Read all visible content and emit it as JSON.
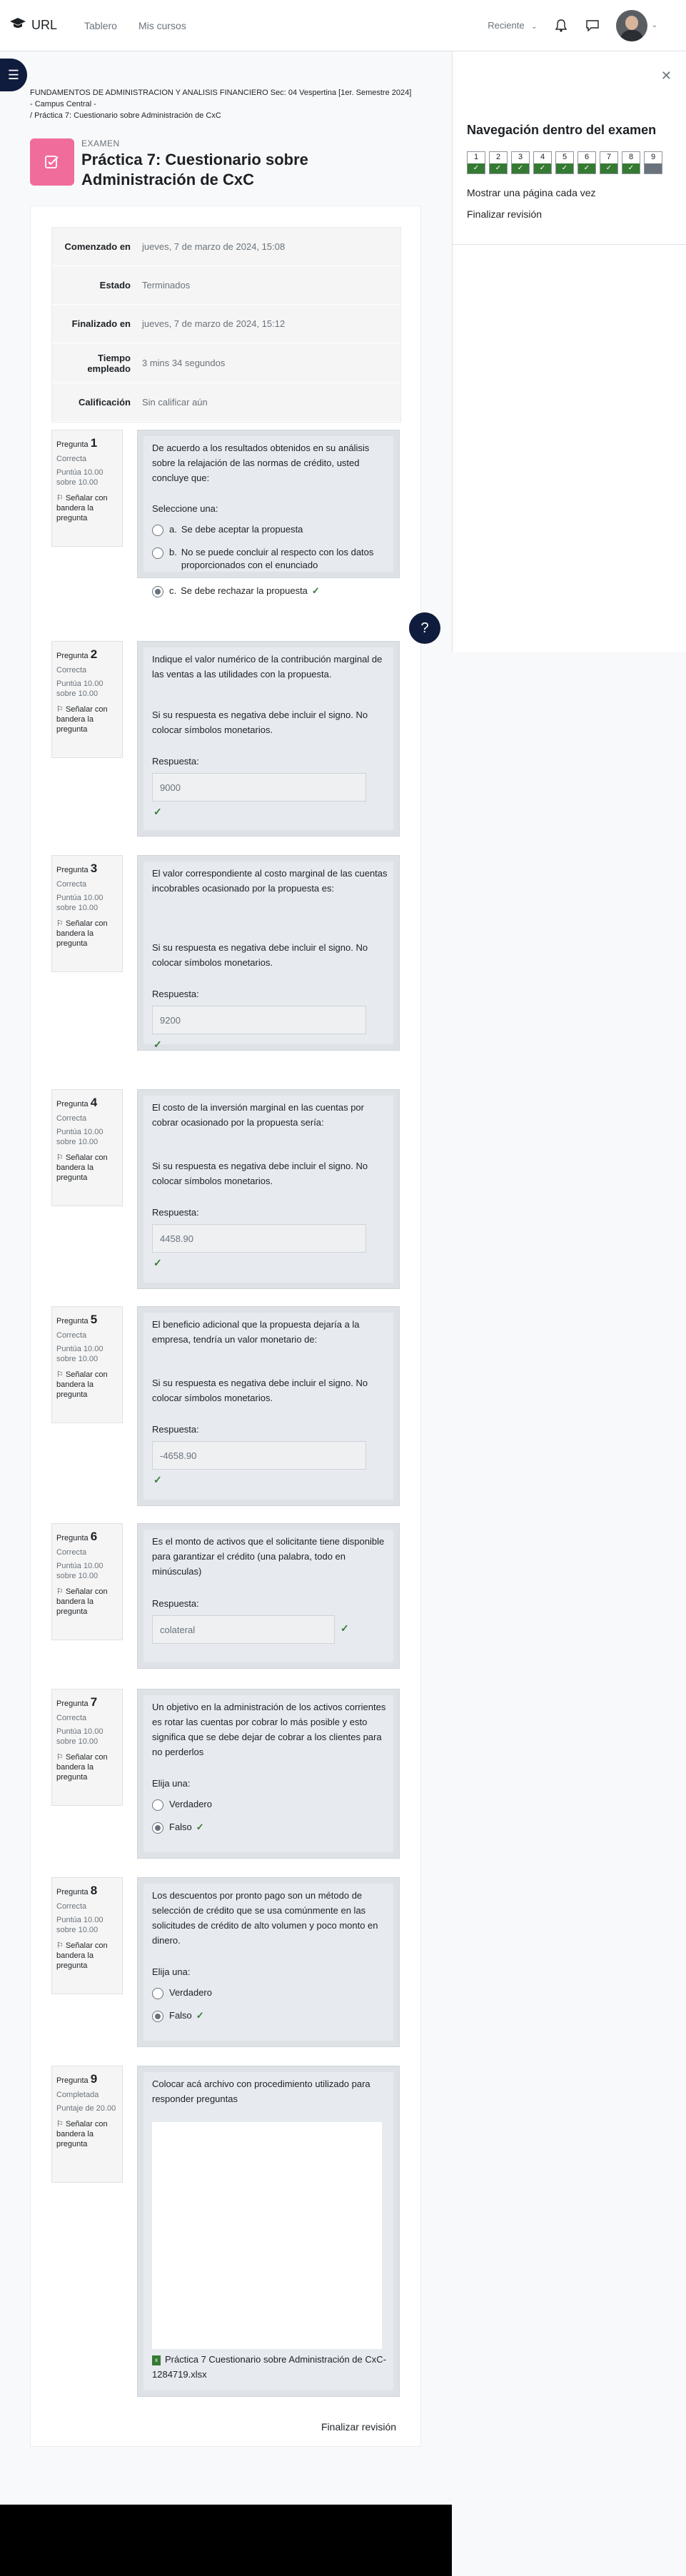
{
  "navbar": {
    "brand": "URL",
    "links": [
      "Tablero",
      "Mis cursos"
    ],
    "recent": "Reciente"
  },
  "breadcrumb": {
    "line1": "FUNDAMENTOS DE ADMINISTRACION Y ANALISIS FINANCIERO Sec: 04 Vespertina [1er. Semestre 2024]",
    "line2": "- Campus Central -",
    "line3": "/ Práctica 7: Cuestionario sobre Administración de CxC"
  },
  "header": {
    "kicker": "EXAMEN",
    "title": "Práctica 7: Cuestionario sobre Administración de CxC"
  },
  "summary": [
    {
      "label": "Comenzado en",
      "value": "jueves, 7 de marzo de 2024, 15:08"
    },
    {
      "label": "Estado",
      "value": "Terminados"
    },
    {
      "label": "Finalizado en",
      "value": "jueves, 7 de marzo de 2024, 15:12"
    },
    {
      "label": "Tiempo empleado",
      "value": "3 mins 34 segundos"
    },
    {
      "label": "Calificación",
      "value": "Sin calificar aún"
    }
  ],
  "common": {
    "pregunta": "Pregunta",
    "flag": "Señalar con bandera la pregunta",
    "respuesta": "Respuesta:",
    "seleccione": "Seleccione una:",
    "elija": "Elija una:",
    "check": "✓"
  },
  "questions": [
    {
      "num": "1",
      "state": "Correcta",
      "marks": "Puntúa 10.00 sobre 10.00",
      "text": "De acuerdo a los resultados obtenidos en su análisis sobre la relajación de las normas de crédito, usted concluye que:",
      "options": [
        {
          "letter": "a.",
          "text": "Se debe aceptar la propuesta"
        },
        {
          "letter": "b.",
          "text": "No se puede concluir al respecto con los datos proporcionados con el enunciado"
        },
        {
          "letter": "c.",
          "text": "Se debe rechazar la propuesta"
        }
      ]
    },
    {
      "num": "2",
      "state": "Correcta",
      "marks": "Puntúa 10.00 sobre 10.00",
      "text": "Indique el valor numérico de la contribución marginal de las ventas a las utilidades con la propuesta.",
      "note": "Si su respuesta es negativa debe incluir el signo.  No colocar símbolos monetarios.",
      "answer": "9000"
    },
    {
      "num": "3",
      "state": "Correcta",
      "marks": "Puntúa 10.00 sobre 10.00",
      "text": "El valor correspondiente al costo marginal de las cuentas incobrables ocasionado por la propuesta es:",
      "note": "Si su respuesta es negativa debe incluir el signo.  No colocar símbolos monetarios.",
      "answer": "9200"
    },
    {
      "num": "4",
      "state": "Correcta",
      "marks": "Puntúa 10.00 sobre 10.00",
      "text": "El costo de la inversión marginal en las cuentas por cobrar ocasionado por la propuesta sería:",
      "note": "Si su respuesta es negativa debe incluir el signo.  No colocar símbolos monetarios.",
      "answer": "4458.90"
    },
    {
      "num": "5",
      "state": "Correcta",
      "marks": "Puntúa 10.00 sobre 10.00",
      "text": "El beneficio adicional que la propuesta dejaría a la empresa, tendría un valor monetario de:",
      "note": "Si su respuesta es negativa debe incluir el signo.  No colocar símbolos monetarios.",
      "answer": "-4658.90"
    },
    {
      "num": "6",
      "state": "Correcta",
      "marks": "Puntúa 10.00 sobre 10.00",
      "text": "Es el monto de activos que el solicitante tiene disponible para garantizar el crédito   (una palabra, todo en minúsculas)",
      "answer": "colateral"
    },
    {
      "num": "7",
      "state": "Correcta",
      "marks": "Puntúa 10.00 sobre 10.00",
      "text": "Un objetivo en la administración de los activos corrientes es rotar las cuentas por cobrar lo más posible y esto significa que se debe dejar de cobrar a los clientes para no perderlos",
      "options": [
        {
          "text": "Verdadero"
        },
        {
          "text": "Falso"
        }
      ]
    },
    {
      "num": "8",
      "state": "Correcta",
      "marks": "Puntúa 10.00 sobre 10.00",
      "text": "Los descuentos por pronto pago son un método de selección de crédito que se usa comúnmente en las solicitudes de crédito de alto volumen y poco monto en dinero.",
      "options": [
        {
          "text": "Verdadero"
        },
        {
          "text": "Falso"
        }
      ]
    },
    {
      "num": "9",
      "state": "Completada",
      "marks": "Puntaje de 20.00",
      "text": "Colocar acá archivo con procedimiento utilizado para responder preguntas",
      "file": "Práctica 7 Cuestionario sobre Administración de CxC-1284719.xlsx"
    }
  ],
  "drawer": {
    "title": "Navegación dentro del examen",
    "nav_numbers": [
      "1",
      "2",
      "3",
      "4",
      "5",
      "6",
      "7",
      "8",
      "9"
    ],
    "one_page": "Mostrar una página cada vez",
    "finish": "Finalizar revisión"
  },
  "finish_link": "Finalizar revisión",
  "colors": {
    "correct": "#357a32",
    "accent_icon": "#f06c9b",
    "dark": "#0f1c3d"
  }
}
